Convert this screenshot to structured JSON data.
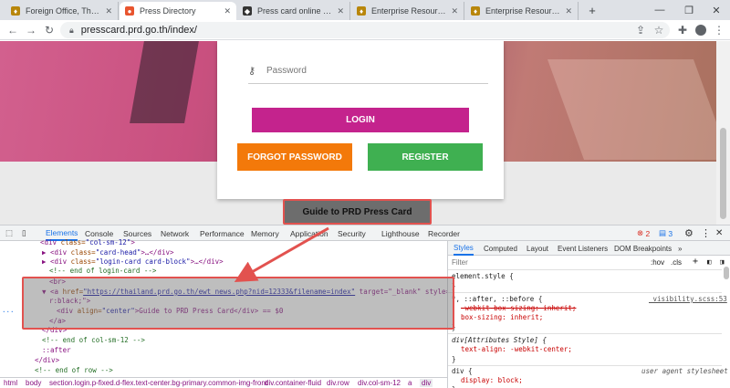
{
  "browser": {
    "tabs": [
      {
        "label": "Foreign Office, The Gove",
        "active": false
      },
      {
        "label": "Press Directory",
        "active": true
      },
      {
        "label": "Press card online Regstra",
        "active": false
      },
      {
        "label": "Enterprise Resource Plan",
        "active": false
      },
      {
        "label": "Enterprise Resource Plan",
        "active": false
      }
    ],
    "new_tab": "+",
    "url": "presscard.prd.go.th/index/"
  },
  "login_page": {
    "password_placeholder": "Password",
    "login_label": "LOGIN",
    "forgot_label": "FORGOT PASSWORD",
    "register_label": "REGISTER",
    "guide_label": "Guide to PRD Press Card"
  },
  "devtools": {
    "tabs": [
      "Elements",
      "Console",
      "Sources",
      "Network",
      "Performance",
      "Memory",
      "Application",
      "Security",
      "Lighthouse",
      "Recorder"
    ],
    "error_count": "2",
    "message_count": "3",
    "dom_lines": [
      {
        "pre": "<div ",
        "attr": "class=",
        "val": "\"col-sm-12\"",
        "post": ">"
      },
      {
        "pre": "▶ <div ",
        "attr": "class=",
        "val": "\"card-head\"",
        "post": ">…</div>"
      },
      {
        "pre": "▶ <div ",
        "attr": "class=",
        "val": "\"login-card card-block\"",
        "post": ">…</div>"
      },
      {
        "comment": "<!-- end of login-card -->"
      },
      {
        "pre": "<br>"
      },
      {
        "pre": "▼ <a ",
        "attr": "href=",
        "val": "\"https://thailand.prd.go.th/ewt_news.php?nid=12333&filename=index\"",
        "post": " target=\"_blank\" style=\"colo"
      },
      {
        "pre": "r:black;\">"
      },
      {
        "pre": "<div ",
        "attr": "align=",
        "val": "\"center\"",
        "post": ">Guide to PRD Press Card</div> == $0"
      },
      {
        "pre": "</a>"
      },
      {
        "pre": "</div>"
      },
      {
        "comment": "<!-- end of col-sm-12 -->"
      },
      {
        "pre": "::after"
      },
      {
        "pre": "</div>"
      },
      {
        "comment": "<!-- end of row -->"
      }
    ],
    "styles_tabs": [
      "Styles",
      "Computed",
      "Layout",
      "Event Listeners",
      "DOM Breakpoints",
      "»"
    ],
    "filter_placeholder": "Filter",
    "hov": ":hov",
    "cls": ".cls",
    "style_lines": [
      "element.style {",
      "}",
      "*, ::after, ::before {",
      "-webkit-box-sizing: inherit;",
      "box-sizing: inherit;",
      "}",
      "div[Attributes Style] {",
      "text-align: -webkit-center;",
      "}",
      "div {",
      "display: block;",
      "}"
    ],
    "source_visibility": "_visibility.scss:53",
    "source_ua": "user agent stylesheet",
    "breadcrumbs": [
      "html",
      "body",
      "section.login.p-fixed.d-flex.text-center.bg-primary.common-img-front",
      "div.container-fluid",
      "div.row",
      "div.col-sm-12",
      "a",
      "div"
    ]
  },
  "colors": {
    "login": "#c4238d",
    "forgot": "#f3790a",
    "register": "#3fb051",
    "annotation": "#e2524f"
  }
}
